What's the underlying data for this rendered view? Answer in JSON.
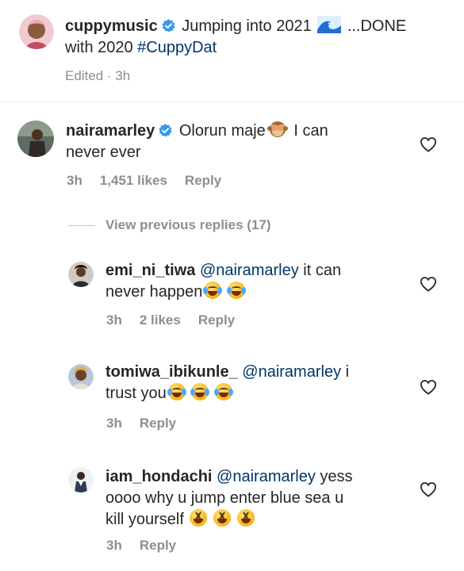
{
  "caption": {
    "username": "cuppymusic",
    "text_part1": " Jumping into 2021 ",
    "text_part2": " ...DONE",
    "line2_prefix": "with 2020 ",
    "hashtag": "#CuppyDat",
    "edited": "Edited · 3h"
  },
  "comment": {
    "username": "nairamarley",
    "text_part1": " Olorun maje",
    "text_part2": " I can",
    "line2": "never ever",
    "time": "3h",
    "likes": "1,451 likes",
    "reply": "Reply"
  },
  "view_previous": "View previous replies (17)",
  "replies": [
    {
      "username": "emi_ni_tiwa",
      "mention": "@nairamarley",
      "text_line1_rest": " it can",
      "text_line2": "never happen",
      "time": "3h",
      "likes": "2 likes",
      "reply": "Reply"
    },
    {
      "username": "tomiwa_ibikunle_",
      "mention": "@nairamarley",
      "text_line1_rest": " i",
      "text_line2": "trust you",
      "time": "3h",
      "reply": "Reply"
    },
    {
      "username": "iam_hondachi",
      "mention": "@nairamarley",
      "text_line1_rest": " yess",
      "text_line2": "oooo why u jump enter blue sea u",
      "text_line3": "kill yourself ",
      "time": "3h",
      "reply": "Reply"
    }
  ],
  "icons": [
    "verified-badge-icon",
    "heart-icon",
    "wave-emoji-icon",
    "see-no-evil-monkey-icon",
    "laughing-tears-emoji-icon",
    "squinting-laugh-emoji-icon"
  ],
  "colors": {
    "text": "#262626",
    "meta": "#8e8e8e",
    "link": "#003569",
    "verified": "#3897f0",
    "divider": "#efefef"
  }
}
